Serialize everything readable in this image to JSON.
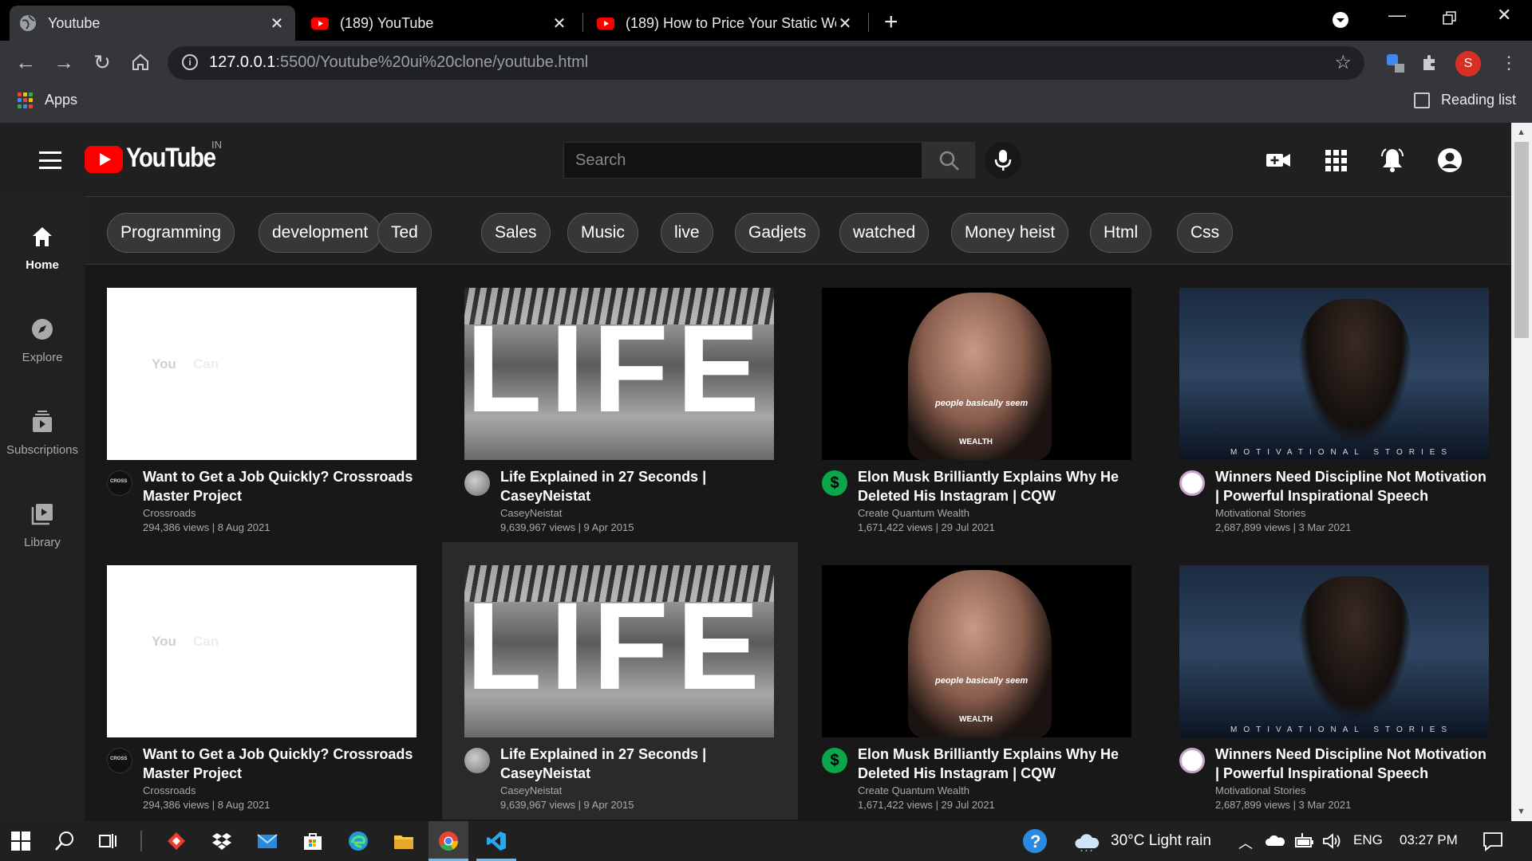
{
  "browser": {
    "tabs": [
      {
        "title": "Youtube",
        "active": true
      },
      {
        "title": "(189) YouTube",
        "active": false
      },
      {
        "title": "(189) How to Price Your Static We",
        "active": false
      }
    ],
    "address": {
      "host": "127.0.0.1",
      "path": ":5500/Youtube%20ui%20clone/youtube.html"
    },
    "bookmarks": {
      "apps_label": "Apps",
      "reading_list_label": "Reading list"
    },
    "profile_initial": "S"
  },
  "youtube": {
    "wordmark": "YouTube",
    "country": "IN",
    "search_placeholder": "Search",
    "chips": [
      "Programming",
      "development",
      "Ted",
      "Sales",
      "Music",
      "live",
      "Gadjets",
      "watched",
      "Money heist",
      "Html",
      "Css"
    ],
    "sidebar": [
      {
        "label": "Home",
        "icon": "home-icon"
      },
      {
        "label": "Explore",
        "icon": "compass-icon"
      },
      {
        "label": "Subscriptions",
        "icon": "subscriptions-icon"
      },
      {
        "label": "Library",
        "icon": "library-icon"
      }
    ],
    "videos": [
      {
        "title": "Want to Get a Job Quickly? Crossroads Master Project",
        "channel": "Crossroads",
        "meta": "294,386 views | 8 Aug 2021",
        "thumb_text": [
          "You",
          "Can"
        ],
        "avatar_text": "CROSS"
      },
      {
        "title": "Life Explained in 27 Seconds | CaseyNeistat",
        "channel": "CaseyNeistat",
        "meta": "9,639,967 views | 9 Apr 2015",
        "thumb_text": [
          "LIFE"
        ]
      },
      {
        "title": "Elon Musk Brilliantly Explains Why He Deleted His Instagram | CQW",
        "channel": "Create Quantum Wealth",
        "meta": "1,671,422 views | 29 Jul 2021",
        "thumb_text": [
          "people basically seem",
          "WEALTH"
        ]
      },
      {
        "title": "Winners Need Discipline Not Motivation | Powerful Inspirational Speech",
        "channel": "Motivational Stories",
        "meta": "2,687,899 views | 3 Mar 2021",
        "thumb_text": [
          "MOTIVATIONAL STORIES"
        ]
      }
    ]
  },
  "taskbar": {
    "weather": "30°C  Light rain",
    "lang": "ENG",
    "time": "03:27 PM"
  }
}
